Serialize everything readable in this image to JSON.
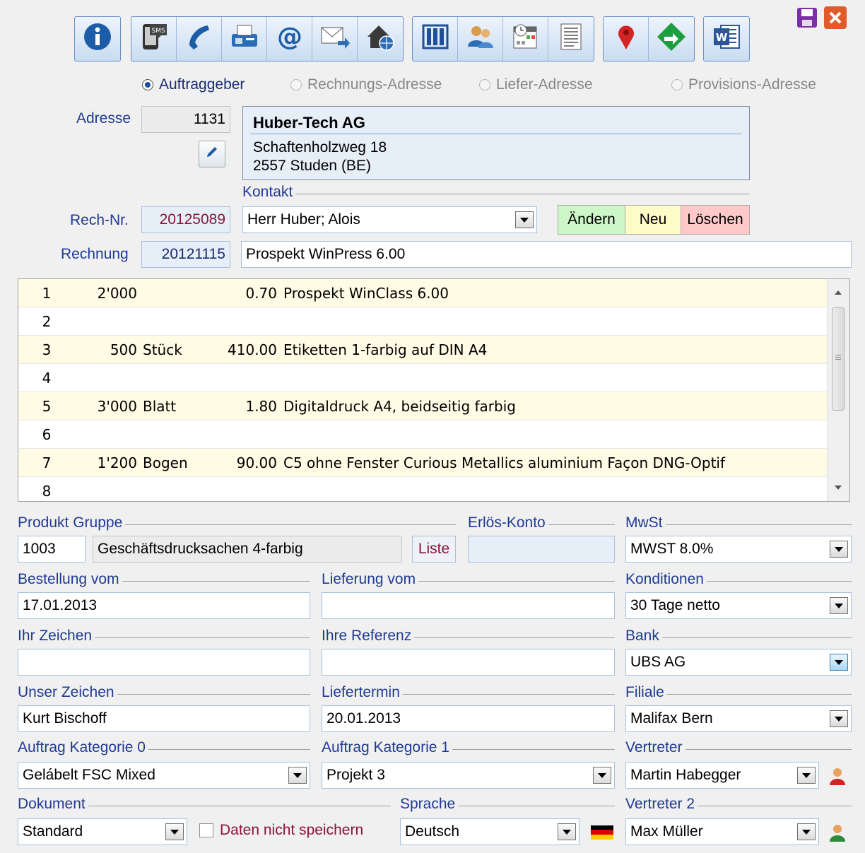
{
  "toolbar": {
    "groups": [
      [
        "info-icon"
      ],
      [
        "sms-icon",
        "phone-icon",
        "fax-icon",
        "at-email-icon",
        "envelope-send-icon",
        "home-web-icon"
      ],
      [
        "abacus-icon",
        "users-icon",
        "calendar-icon",
        "document-list-icon"
      ],
      [
        "map-pin-icon",
        "route-arrow-icon"
      ],
      [
        "word-icon"
      ]
    ]
  },
  "window": {
    "save_icon": "floppy-save-icon",
    "close_icon": "close-icon"
  },
  "address_type": {
    "options": [
      "Auftraggeber",
      "Rechnungs-Adresse",
      "Liefer-Adresse",
      "Provisions-Adresse"
    ],
    "selected": "Auftraggeber"
  },
  "address": {
    "label": "Adresse",
    "number": "1131",
    "company": "Huber-Tech AG",
    "street": "Schaftenholzweg 18",
    "city": "2557 Studen (BE)"
  },
  "contact": {
    "label": "Kontakt",
    "value": "Herr Huber; Alois",
    "btn_change": "Ändern",
    "btn_new": "Neu",
    "btn_delete": "Löschen"
  },
  "invoice": {
    "rech_label": "Rech-Nr.",
    "rech_value": "20125089",
    "rechnung_label": "Rechnung",
    "rechnung_value": "20121115",
    "title": "Prospekt WinPress 6.00"
  },
  "positions": [
    {
      "no": "1",
      "qty": "2'000",
      "unit": "",
      "price": "0.70",
      "desc": "Prospekt WinClass 6.00"
    },
    {
      "no": "2",
      "qty": "",
      "unit": "",
      "price": "",
      "desc": ""
    },
    {
      "no": "3",
      "qty": "500",
      "unit": "Stück",
      "price": "410.00",
      "desc": "Etiketten 1-farbig auf DIN A4"
    },
    {
      "no": "4",
      "qty": "",
      "unit": "",
      "price": "",
      "desc": ""
    },
    {
      "no": "5",
      "qty": "3'000",
      "unit": "Blatt",
      "price": "1.80",
      "desc": "Digitaldruck A4, beidseitig farbig"
    },
    {
      "no": "6",
      "qty": "",
      "unit": "",
      "price": "",
      "desc": ""
    },
    {
      "no": "7",
      "qty": "1'200",
      "unit": "Bogen",
      "price": "90.00",
      "desc": "C5 ohne Fenster Curious Metallics aluminium Façon DNG-Optif"
    },
    {
      "no": "8",
      "qty": "",
      "unit": "",
      "price": "",
      "desc": ""
    }
  ],
  "form": {
    "produkt_gruppe": {
      "label": "Produkt Gruppe",
      "code": "1003",
      "name": "Geschäftsdrucksachen 4-farbig",
      "btn": "Liste"
    },
    "erloes_konto": {
      "label": "Erlös-Konto",
      "value": ""
    },
    "mwst": {
      "label": "MwSt",
      "value": "MWST 8.0%"
    },
    "bestellung": {
      "label": "Bestellung vom",
      "value": "17.01.2013"
    },
    "lieferung": {
      "label": "Lieferung vom",
      "value": ""
    },
    "konditionen": {
      "label": "Konditionen",
      "value": "30 Tage netto"
    },
    "ihr_zeichen": {
      "label": "Ihr Zeichen",
      "value": ""
    },
    "ihre_referenz": {
      "label": "Ihre Referenz",
      "value": ""
    },
    "bank": {
      "label": "Bank",
      "value": "UBS AG"
    },
    "unser_zeichen": {
      "label": "Unser Zeichen",
      "value": "Kurt Bischoff"
    },
    "liefertermin": {
      "label": "Liefertermin",
      "value": "20.01.2013"
    },
    "filiale": {
      "label": "Filiale",
      "value": "Malifax Bern"
    },
    "kat0": {
      "label": "Auftrag Kategorie 0",
      "value": "Gelábelt FSC Mixed"
    },
    "kat1": {
      "label": "Auftrag Kategorie 1",
      "value": "Projekt 3"
    },
    "vertreter": {
      "label": "Vertreter",
      "value": "Martin Habegger"
    },
    "dokument": {
      "label": "Dokument",
      "value": "Standard"
    },
    "nicht_speichern": {
      "label": "Daten nicht speichern",
      "checked": false
    },
    "sprache": {
      "label": "Sprache",
      "value": "Deutsch"
    },
    "vertreter2": {
      "label": "Vertreter 2",
      "value": "Max Müller"
    }
  }
}
